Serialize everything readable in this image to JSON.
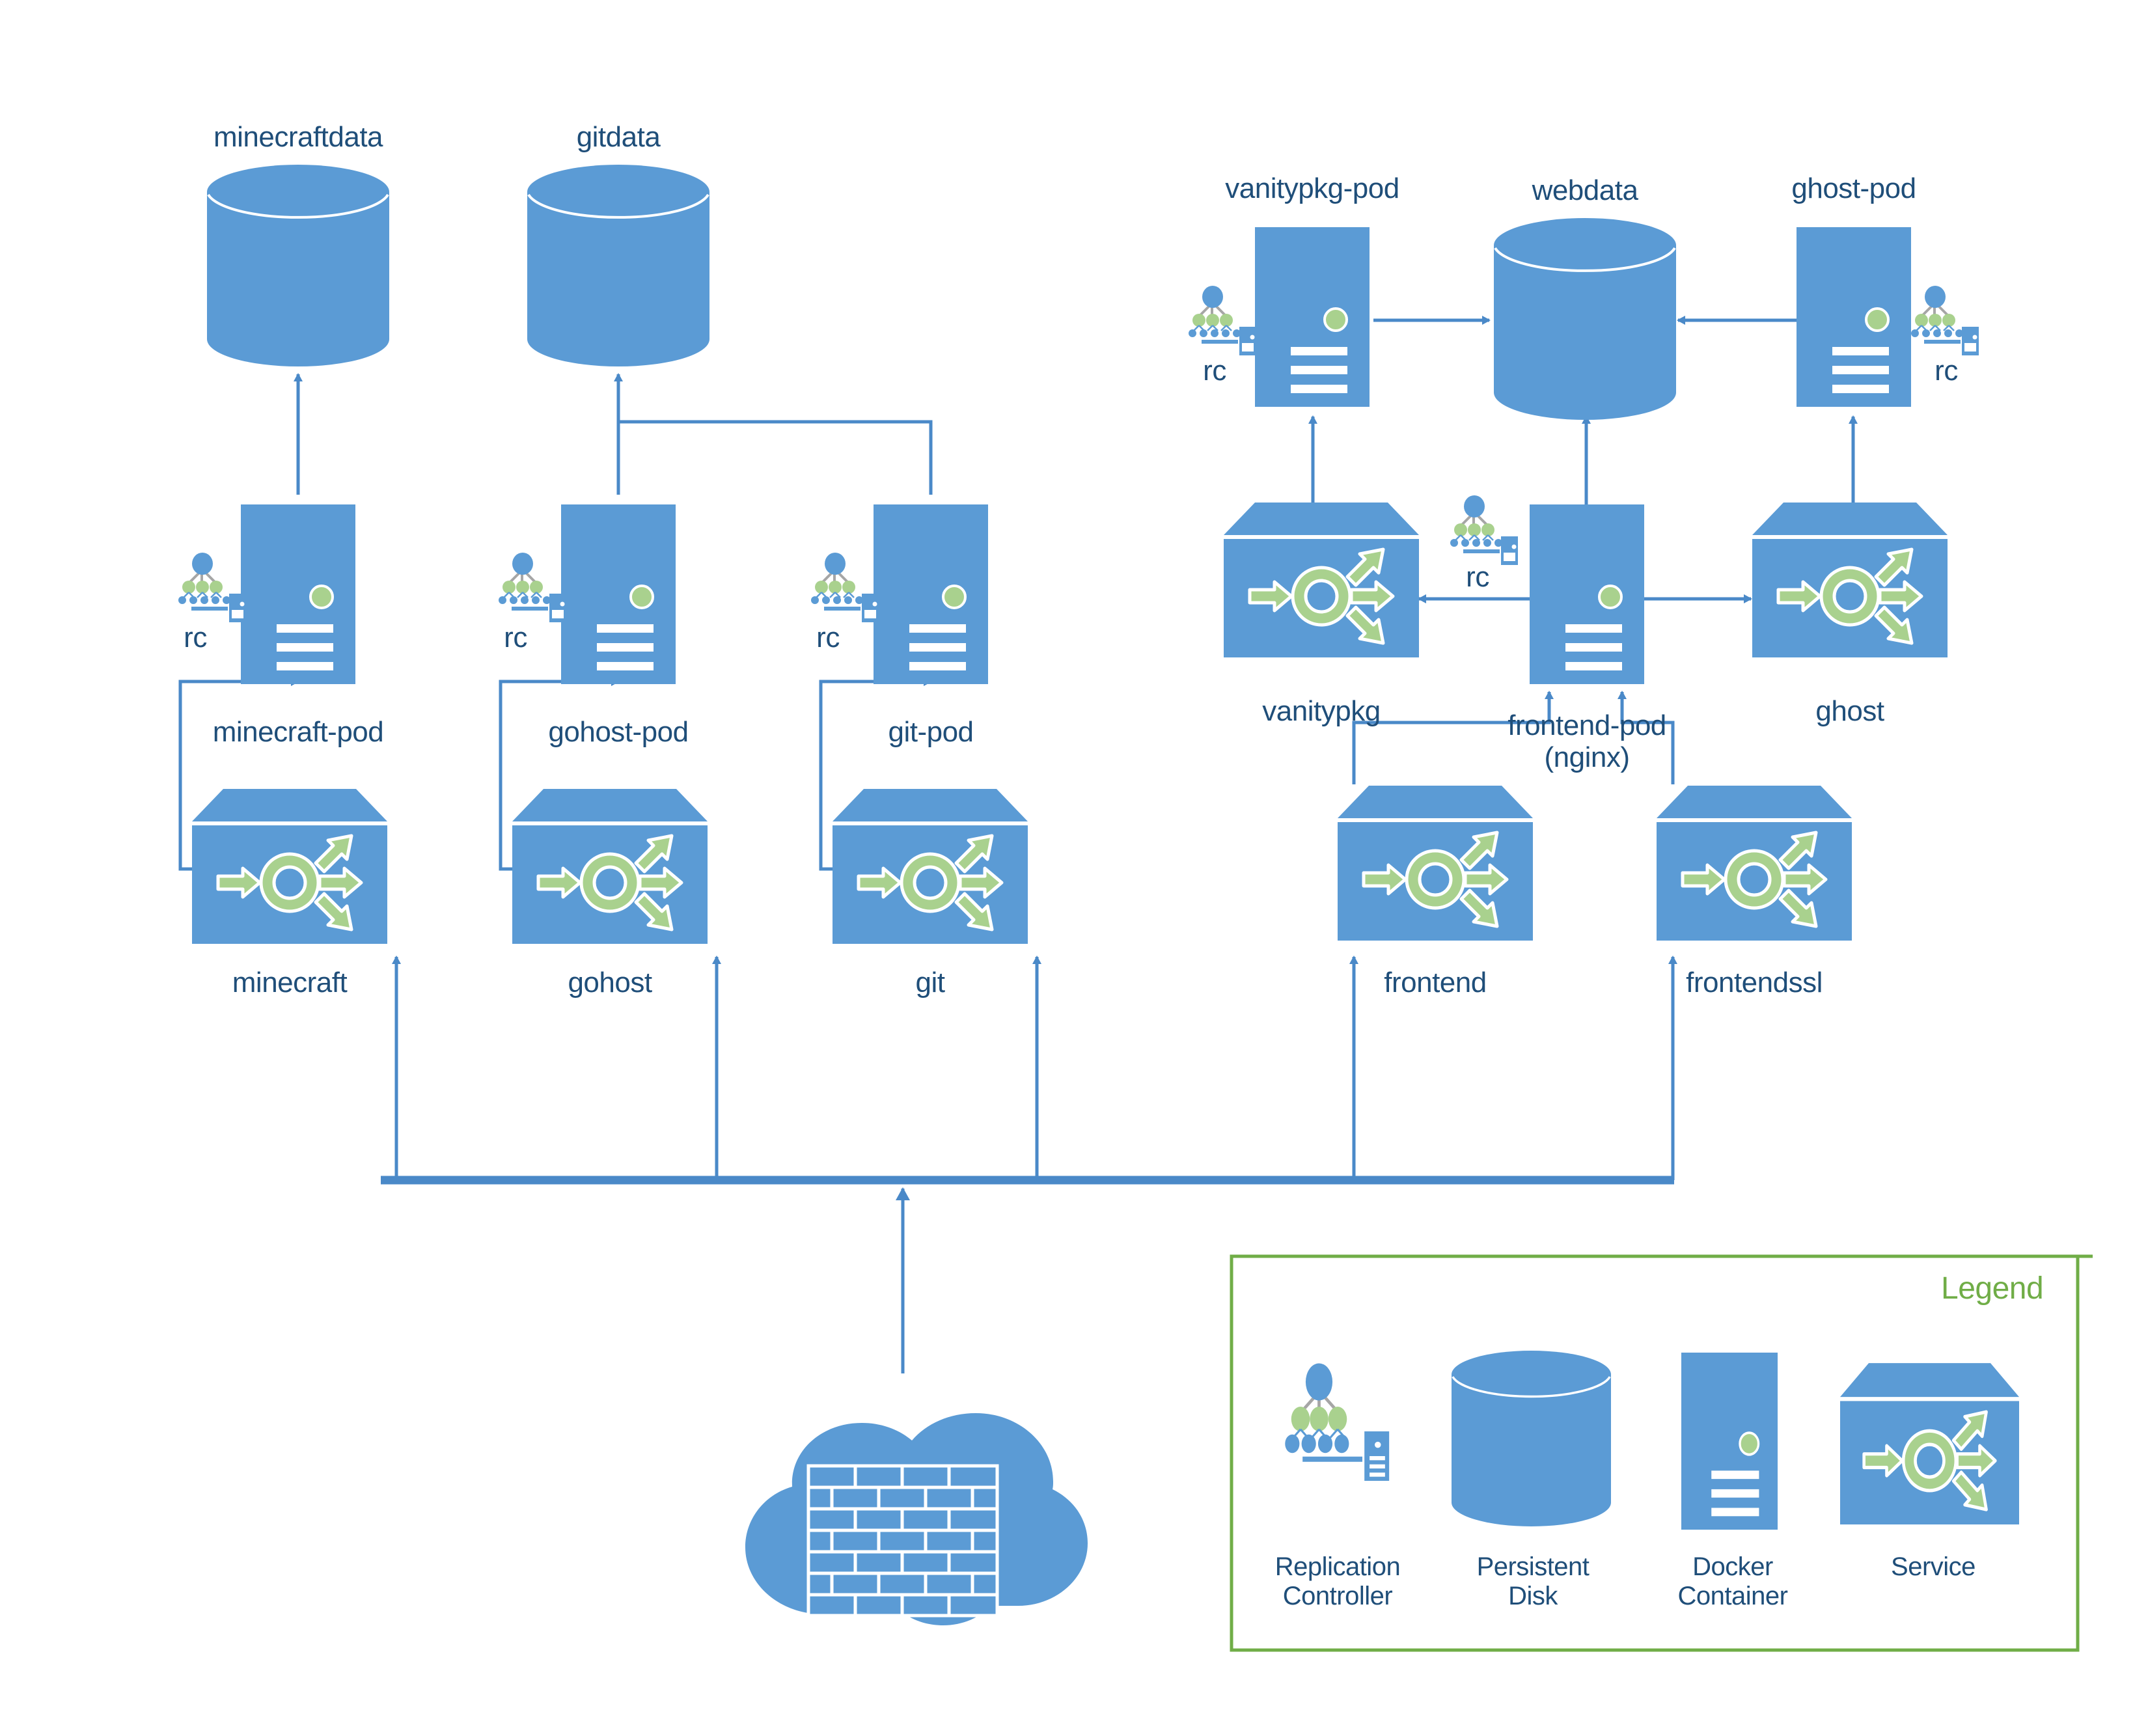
{
  "diagram": {
    "title": "Kubernetes cluster architecture diagram",
    "colors": {
      "blue": "#5B9BD5",
      "green": "#A9D18E",
      "legend_green": "#70AD47",
      "text_navy": "#1F4E79",
      "line_blue": "#4A89C8",
      "white": "#FFFFFF"
    },
    "persistent_disks": [
      {
        "id": "minecraftdata",
        "label": "minecraftdata"
      },
      {
        "id": "gitdata",
        "label": "gitdata"
      },
      {
        "id": "webdata",
        "label": "webdata"
      }
    ],
    "pods": [
      {
        "id": "minecraft-pod",
        "label": "minecraft-pod",
        "rc_label": "rc"
      },
      {
        "id": "gohost-pod",
        "label": "gohost-pod",
        "rc_label": "rc"
      },
      {
        "id": "git-pod",
        "label": "git-pod",
        "rc_label": "rc"
      },
      {
        "id": "vanitypkg-pod",
        "label": "vanitypkg-pod",
        "rc_label": "rc"
      },
      {
        "id": "ghost-pod",
        "label": "ghost-pod",
        "rc_label": "rc"
      },
      {
        "id": "frontend-pod",
        "label": "frontend-pod\n(nginx)",
        "rc_label": "rc"
      }
    ],
    "services": [
      {
        "id": "minecraft",
        "label": "minecraft"
      },
      {
        "id": "gohost",
        "label": "gohost"
      },
      {
        "id": "git",
        "label": "git"
      },
      {
        "id": "vanitypkg",
        "label": "vanitypkg"
      },
      {
        "id": "ghost",
        "label": "ghost"
      },
      {
        "id": "frontend",
        "label": "frontend"
      },
      {
        "id": "frontendssl",
        "label": "frontendssl"
      }
    ],
    "internet": {
      "id": "cloud-firewall",
      "label": ""
    },
    "legend": {
      "title": "Legend",
      "items": [
        {
          "id": "replication-controller",
          "label": "Replication\nController"
        },
        {
          "id": "persistent-disk",
          "label": "Persistent\nDisk"
        },
        {
          "id": "docker-container",
          "label": "Docker\nContainer"
        },
        {
          "id": "service",
          "label": "Service"
        }
      ]
    }
  }
}
